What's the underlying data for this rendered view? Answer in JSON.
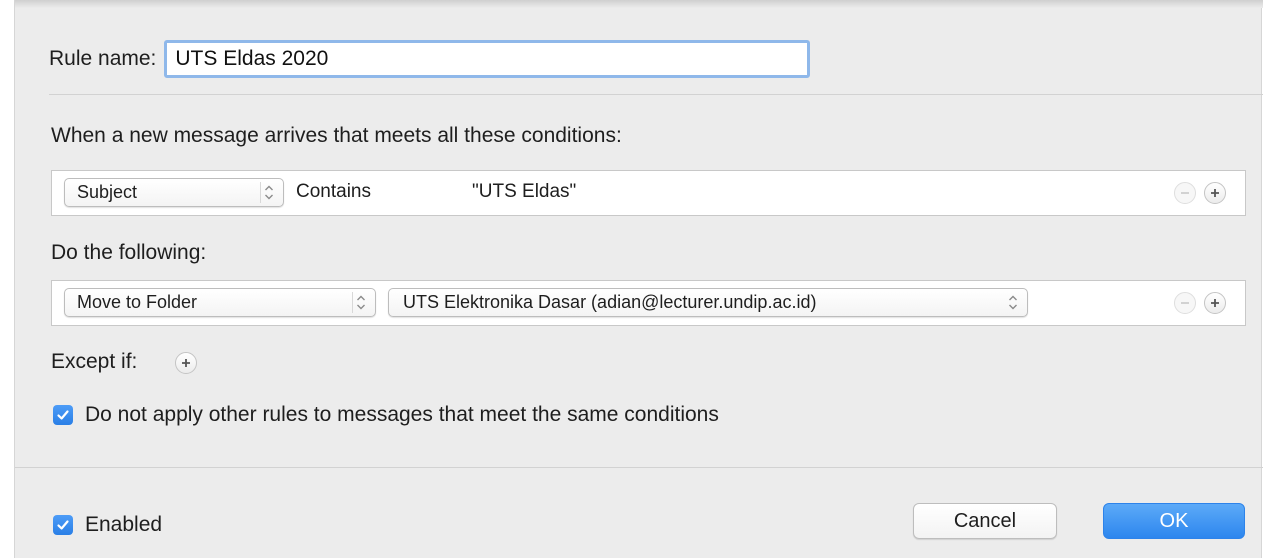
{
  "rule_name": {
    "label": "Rule name:",
    "value": "UTS Eldas 2020"
  },
  "conditions": {
    "heading": "When a new message arrives that meets all these conditions:",
    "rows": [
      {
        "field": "Subject",
        "operator": "Contains",
        "value": "\"UTS Eldas\""
      }
    ]
  },
  "actions": {
    "heading": "Do the following:",
    "rows": [
      {
        "action": "Move to Folder",
        "target": "UTS Elektronika Dasar (adian@lecturer.undip.ac.id)"
      }
    ]
  },
  "except": {
    "label": "Except if:"
  },
  "stop_rules": {
    "checked": true,
    "label": "Do not apply other rules to messages that meet the same conditions"
  },
  "enabled": {
    "checked": true,
    "label": "Enabled"
  },
  "buttons": {
    "cancel": "Cancel",
    "ok": "OK"
  },
  "colors": {
    "accent": "#2d86ee",
    "focus_ring": "#8fb8ea"
  },
  "icons": {
    "popup": "up-down-chevron-icon",
    "add": "plus-icon",
    "remove": "minus-icon",
    "check": "checkmark-icon"
  }
}
